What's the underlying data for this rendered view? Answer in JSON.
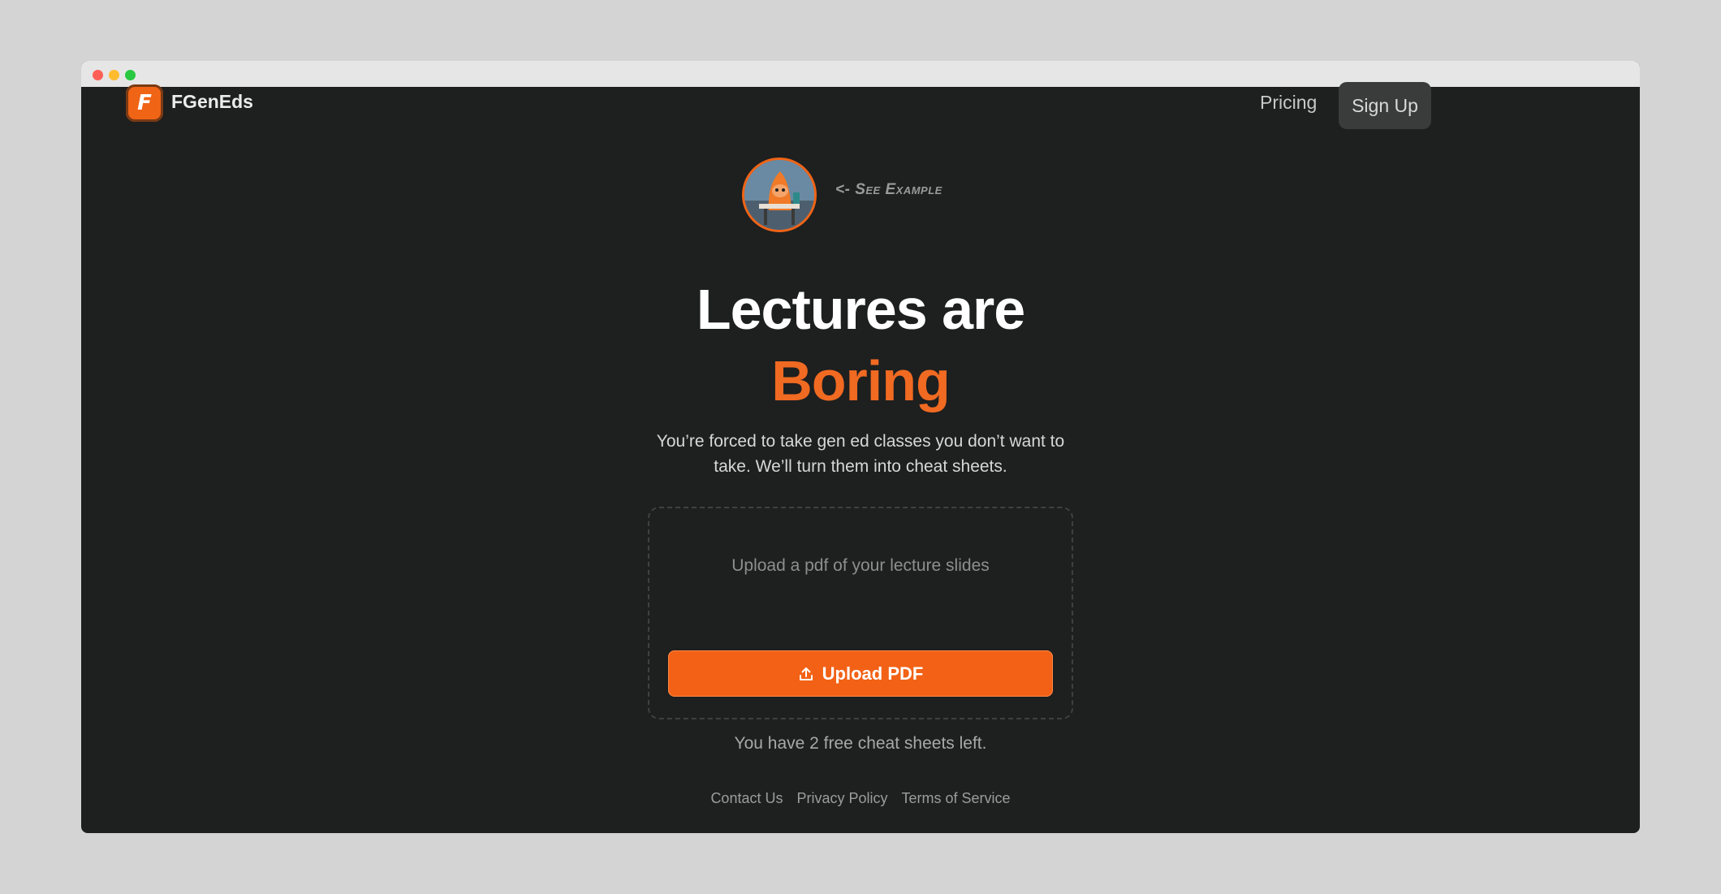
{
  "header": {
    "brand": "FGenEds",
    "logo_letter": "F",
    "nav": {
      "pricing": "Pricing",
      "sign_up": "Sign Up"
    }
  },
  "hero": {
    "see_example": "<- See Example",
    "title_line1": "Lectures are",
    "title_line2": "Boring",
    "subtitle": "You’re forced to take gen ed classes you don’t want to take. We’ll turn them into cheat sheets."
  },
  "upload": {
    "hint": "Upload a pdf of your lecture slides",
    "button_label": "Upload PDF",
    "button_icon": "upload-icon"
  },
  "status": {
    "free_left": "You have 2 free cheat sheets left."
  },
  "footer": {
    "links": [
      "Contact Us",
      "Privacy Policy",
      "Terms of Service"
    ]
  },
  "colors": {
    "accent": "#f26115",
    "background": "#1e1f1f"
  }
}
